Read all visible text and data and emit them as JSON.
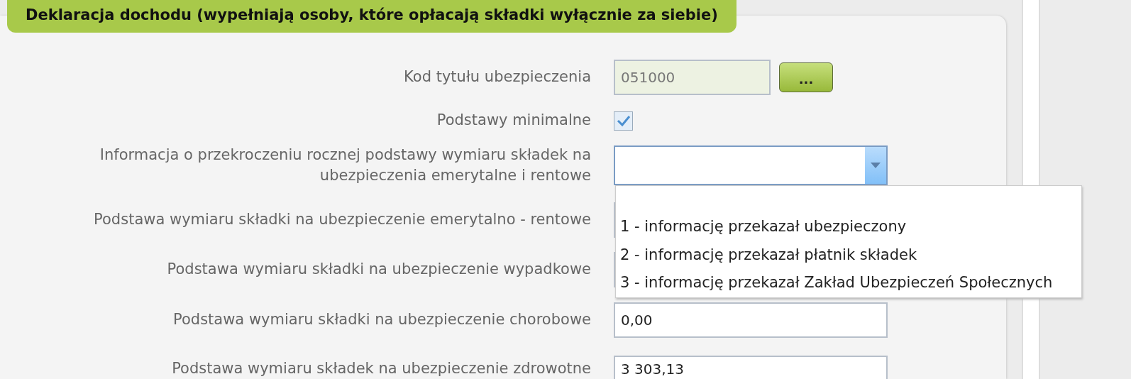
{
  "section": {
    "title": "Deklaracja dochodu (wypełniają osoby, które opłacają składki wyłącznie za siebie)"
  },
  "fields": [
    {
      "kind": "lookup",
      "label": "Kod tytułu ubezpieczenia",
      "value": "051000",
      "disabled": true,
      "button": "..."
    },
    {
      "kind": "checkbox",
      "label": "Podstawy minimalne",
      "checked": true
    },
    {
      "kind": "select",
      "label": "Informacja o przekroczeniu rocznej podstawy wymiaru składek na ubezpieczenia emerytalne i rentowe",
      "expanded": true,
      "options": [
        {
          "label": "1 - informację przekazał ubezpieczony",
          "selected": false
        },
        {
          "label": "2 - informację przekazał płatnik składek",
          "selected": false
        },
        {
          "label": "3 - informację przekazał Zakład Ubezpieczeń Społecznych",
          "selected": false
        }
      ]
    },
    {
      "kind": "text",
      "label": "Podstawa wymiaru składki na ubezpieczenie emerytalno - rentowe"
    },
    {
      "kind": "text",
      "label": "Podstawa wymiaru składki na ubezpieczenie wypadkowe"
    },
    {
      "kind": "text",
      "label": "Podstawa wymiaru składki na ubezpieczenie chorobowe",
      "value": "0,00"
    },
    {
      "kind": "text",
      "label": "Podstawa wymiaru składek na ubezpieczenie zdrowotne",
      "value": "3 303,13"
    }
  ]
}
